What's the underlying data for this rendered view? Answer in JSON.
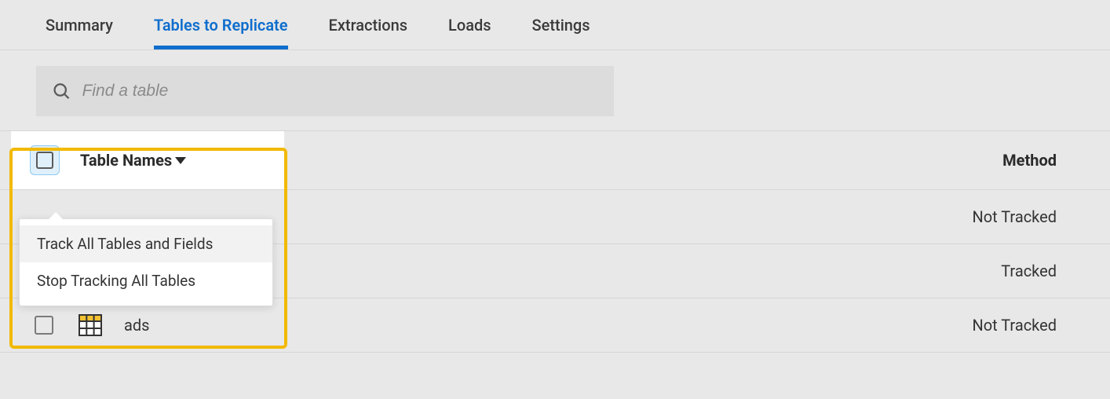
{
  "tabs": [
    {
      "label": "Summary",
      "active": false
    },
    {
      "label": "Tables to Replicate",
      "active": true
    },
    {
      "label": "Extractions",
      "active": false
    },
    {
      "label": "Loads",
      "active": false
    },
    {
      "label": "Settings",
      "active": false
    }
  ],
  "search": {
    "placeholder": "Find a table"
  },
  "header": {
    "table_names_label": "Table Names",
    "method_label": "Method"
  },
  "dropdown": {
    "items": [
      {
        "label": "Track All Tables and Fields",
        "hover": true
      },
      {
        "label": "Stop Tracking All Tables",
        "hover": false
      }
    ]
  },
  "rows": [
    {
      "name": "",
      "method": "Not Tracked",
      "masked": true
    },
    {
      "name": "",
      "method": "Tracked",
      "masked": true
    },
    {
      "name": "ads",
      "method": "Not Tracked",
      "masked": false
    }
  ]
}
